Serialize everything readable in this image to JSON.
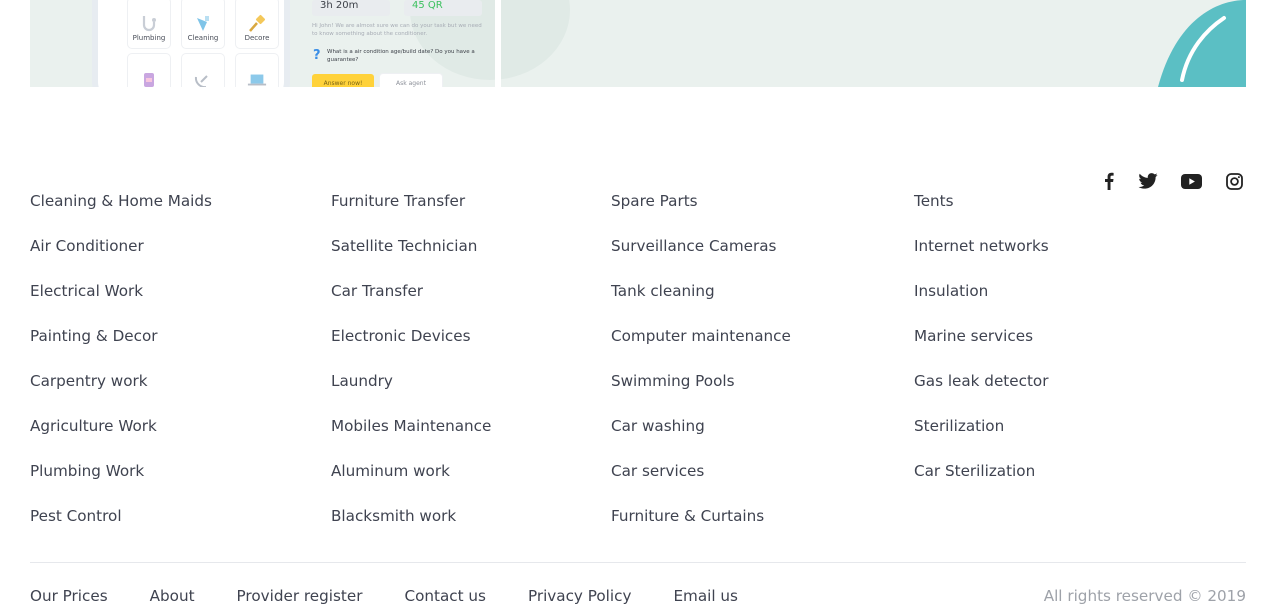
{
  "hero": {
    "categories": [
      "Plumbing",
      "Cleaning",
      "Decore"
    ],
    "duration": "3h 20m",
    "price": "45 QR",
    "chat_message": "Hi John! We are almost sure we can do your task but we need to know something about the conditioner.",
    "question": "What is a air condition age/build date? Do you have a guarantee?",
    "answer_button": "Answer now!",
    "ask_button": "Ask agent",
    "accent_color": "#5bbfc4",
    "highlight_color": "#ffd23a"
  },
  "social": [
    {
      "name": "facebook-icon"
    },
    {
      "name": "twitter-icon"
    },
    {
      "name": "youtube-icon"
    },
    {
      "name": "instagram-icon"
    }
  ],
  "services": {
    "col1": [
      "Cleaning & Home Maids",
      "Air Conditioner",
      "Electrical Work",
      "Painting & Decor",
      "Carpentry work",
      "Agriculture Work",
      "Plumbing Work",
      "Pest Control"
    ],
    "col2": [
      "Furniture Transfer",
      "Satellite Technician",
      "Car Transfer",
      "Electronic Devices",
      "Laundry",
      "Mobiles Maintenance",
      "Aluminum work",
      "Blacksmith work"
    ],
    "col3": [
      "Spare Parts",
      "Surveillance Cameras",
      "Tank cleaning",
      "Computer maintenance",
      "Swimming Pools",
      "Car washing",
      "Car services",
      "Furniture & Curtains"
    ],
    "col4": [
      "Tents",
      "Internet networks",
      "Insulation",
      "Marine services",
      "Gas leak detector",
      "Sterilization",
      "Car Sterilization"
    ]
  },
  "footer": {
    "links": [
      "Our Prices",
      "About",
      "Provider register",
      "Contact us",
      "Privacy Policy",
      "Email us"
    ],
    "copyright": "All rights reserved © 2019"
  }
}
